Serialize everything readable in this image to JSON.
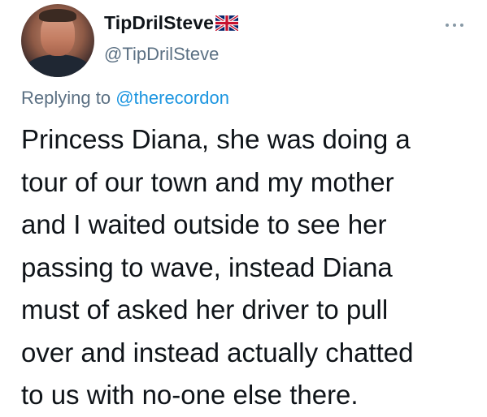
{
  "tweet": {
    "author": {
      "display_name": "TipDrilSteve",
      "username": "@TipDrilSteve",
      "flag_icon": "uk-flag-icon"
    },
    "more_icon": "more-horizontal-icon",
    "replying": {
      "prefix": "Replying to",
      "mention": "@therecordon"
    },
    "text_lines": [
      "Princess Diana, she was doing a",
      "tour of our town and my mother",
      "and I waited outside to see her",
      "passing to wave, instead Diana",
      "must of asked her driver to pull",
      "over and instead actually chatted",
      "to us with no-one else there."
    ]
  },
  "colors": {
    "text": "#0f1419",
    "secondary": "#5b7083",
    "link": "#1b95e0"
  }
}
